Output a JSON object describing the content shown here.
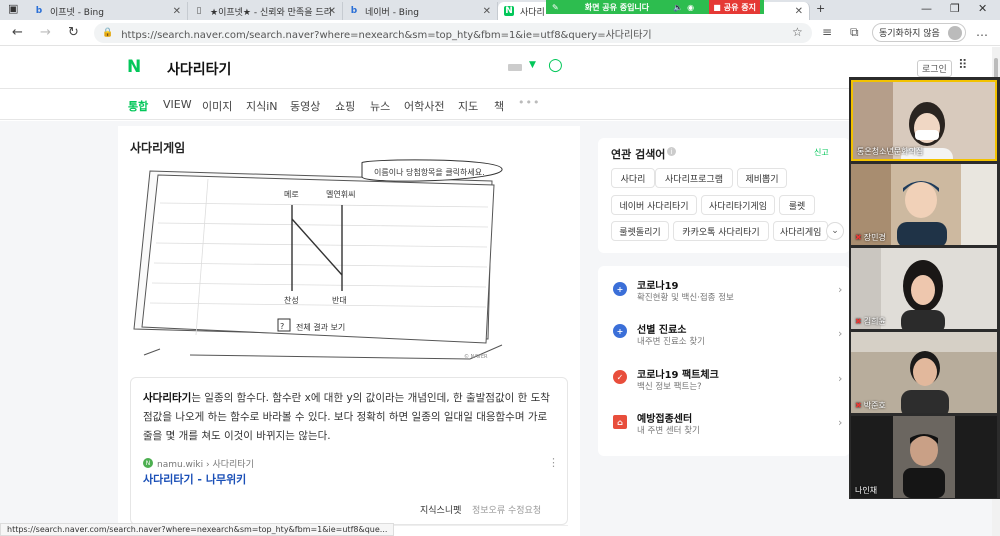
{
  "browser": {
    "tabs": [
      {
        "title": "이프넷 - Bing",
        "icon": "bing-icon"
      },
      {
        "title": "★이프넷★ - 신뢰와 만족을 드리",
        "icon": "page-icon"
      },
      {
        "title": "네이버 - Bing",
        "icon": "bing-icon"
      },
      {
        "title": "사다리",
        "icon": "naver-icon",
        "active": true
      }
    ],
    "share_banner": "화면 공유 중입니다",
    "share_stop": "공유 중지",
    "url": "https://search.naver.com/search.naver?where=nexearch&sm=top_hty&fbm=1&ie=utf8&query=사다리타기",
    "sync_label": "동기화하지 않음",
    "status_url": "https://search.naver.com/search.naver?where=nexearch&sm=top_hty&fbm=1&ie=utf8&que..."
  },
  "naver": {
    "logo": "N",
    "query": "사다리타기",
    "login": "로그인",
    "tabs": [
      "통합",
      "VIEW",
      "이미지",
      "지식iN",
      "동영상",
      "쇼핑",
      "뉴스",
      "어학사전",
      "지도",
      "책"
    ],
    "more": "•••"
  },
  "main": {
    "section_title": "사다리게임",
    "ladder": {
      "speech": "이름이나 당첨항목을 클릭하세요.",
      "top_left": "메로",
      "top_right": "멜연휘씨",
      "bottom_left": "찬성",
      "bottom_right": "반대",
      "result_button": "전체 결과 보기",
      "watermark": "© NAVER"
    },
    "description_bold": "사다리타기",
    "description_rest": "는 일종의 함수다. 함수란 x에 대한 y의 값이라는 개념인데, 한 출발점값이 한 도착점값을 나오게 하는 함수로 바라볼 수 있다. 보다 정확히 하면 일종의 일대일 대응함수며 가로줄을 몇 개를 쳐도 이것이 바뀌지는 않는다.",
    "source_site": "namu.wiki › 사다리타기",
    "source_link": "사다리타기 - 나무위키",
    "snippet": "지식스니펫",
    "report": "정보오류 수정요청"
  },
  "related": {
    "title": "연관 검색어",
    "report": "신고",
    "chips": [
      "사다리",
      "사다리프로그램",
      "제비뽑기",
      "네이버 사다리타기",
      "사다리타기게임",
      "룰렛",
      "룰렛돌리기",
      "카카오톡 사다리타기",
      "사다리게임"
    ]
  },
  "covid": {
    "items": [
      {
        "title": "코로나19",
        "sub": "확진현황 및 백신·접종 정보",
        "color": "#3b6fd8",
        "icon": "covid-icon"
      },
      {
        "title": "선별 진료소",
        "sub": "내주변 진료소 찾기",
        "color": "#3b6fd8",
        "icon": "clinic-icon"
      },
      {
        "title": "코로나19 팩트체크",
        "sub": "백신 정보 팩트는?",
        "color": "#e84e3c",
        "icon": "factcheck-icon"
      },
      {
        "title": "예방접종센터",
        "sub": "내 주변 센터 찾기",
        "color": "#e84e3c",
        "icon": "vaccine-center-icon"
      }
    ]
  },
  "video": {
    "participants": [
      {
        "name": "통온청소년문화의집",
        "bg": "#c9b7a8",
        "muted": false
      },
      {
        "name": "장민경",
        "bg": "#bfa98e",
        "muted": true
      },
      {
        "name": "김희윤",
        "bg": "#d8d4cf",
        "muted": true
      },
      {
        "name": "박준호",
        "bg": "#8a7f70",
        "muted": true
      },
      {
        "name": "나인채",
        "bg": "#1c1c1c",
        "muted": false
      }
    ]
  }
}
